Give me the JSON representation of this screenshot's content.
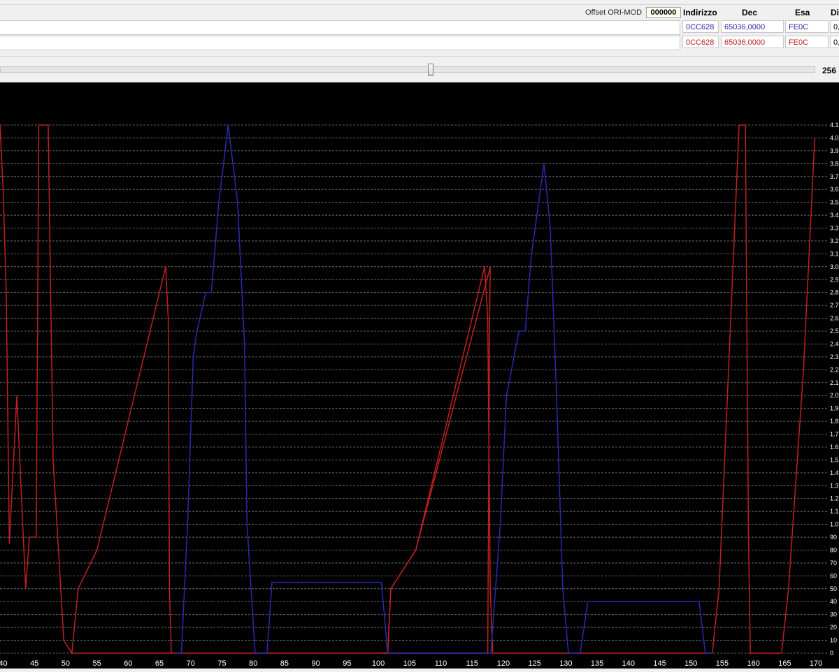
{
  "toolbar": {
    "offset_label": "Offset ORI-MOD",
    "offset_value": "000000",
    "col_address": "Indirizzo",
    "col_dec": "Dec",
    "col_hex": "Esa",
    "col_diff": "Di"
  },
  "rows": [
    {
      "address": "0CC628",
      "dec": "65036,0000",
      "hex": "FE0C",
      "diff": "0,",
      "color": "#2a2ab0"
    },
    {
      "address": "0CC628",
      "dec": "65036,0000",
      "hex": "FE0C",
      "diff": "0,",
      "color": "#c02020"
    }
  ],
  "slider": {
    "value": "256",
    "position": 0.528
  },
  "chart_data": {
    "type": "line",
    "xlim": [
      39.5,
      172
    ],
    "ylim": [
      0,
      4.1
    ],
    "x_ticks": [
      "40",
      "45",
      "50",
      "55",
      "60",
      "65",
      "70",
      "75",
      "80",
      "85",
      "90",
      "95",
      "100",
      "105",
      "110",
      "115",
      "120",
      "125",
      "130",
      "135",
      "140",
      "145",
      "150",
      "155",
      "160",
      "165",
      "170"
    ],
    "y_ticks": [
      "0",
      "10",
      "20",
      "30",
      "40",
      "50",
      "60",
      "70",
      "80",
      "90",
      "1.0",
      "1.1",
      "1.2",
      "1.3",
      "1.4",
      "1.5",
      "1.6",
      "1.7",
      "1.8",
      "1.9",
      "2.0",
      "2.1",
      "2.2",
      "2.3",
      "2.4",
      "2.5",
      "2.6",
      "2.7",
      "2.8",
      "2.9",
      "3.0",
      "3.1",
      "3.2",
      "3.3",
      "3.4",
      "3.5",
      "3.6",
      "3.7",
      "3.8",
      "3.9",
      "4.0",
      "4.1"
    ],
    "grid": true,
    "background": "#000000",
    "series": [
      {
        "color": "#c02020",
        "points": [
          [
            39.5,
            4.1
          ],
          [
            40.0,
            3.6
          ],
          [
            40.5,
            2.8
          ],
          [
            41.0,
            0.85
          ],
          [
            42.2,
            2.0
          ],
          [
            43.6,
            0.5
          ],
          [
            44.2,
            0.9
          ],
          [
            45.3,
            0.9
          ],
          [
            45.7,
            4.1
          ],
          [
            47.2,
            4.1
          ],
          [
            48.0,
            1.5
          ],
          [
            49.7,
            0.1
          ],
          [
            51.0,
            0.0
          ],
          [
            52.0,
            0.5
          ],
          [
            55.0,
            0.8
          ],
          [
            66.0,
            3.0
          ],
          [
            66.4,
            2.6
          ],
          [
            66.6,
            0.5
          ],
          [
            66.9,
            0.0
          ],
          [
            117.5,
            0.0
          ],
          [
            117.8,
            2.6
          ],
          [
            117.9,
            3.0
          ],
          [
            106.0,
            0.8
          ],
          [
            102.0,
            0.5
          ],
          [
            101.5,
            0.0
          ],
          [
            100.5,
            0.0
          ]
        ]
      },
      {
        "color": "#c02020",
        "points": [
          [
            51.0,
            0.0
          ],
          [
            66.9,
            0.0
          ]
        ]
      },
      {
        "color": "#c02020",
        "points": [
          [
            100.5,
            0.0
          ],
          [
            101.5,
            0.0
          ],
          [
            102.0,
            0.5
          ],
          [
            106.0,
            0.8
          ],
          [
            117.0,
            3.0
          ],
          [
            117.5,
            2.6
          ],
          [
            117.9,
            0.5
          ],
          [
            118.3,
            0.0
          ],
          [
            153.4,
            0.0
          ],
          [
            154.5,
            0.5
          ],
          [
            157.7,
            4.1
          ],
          [
            158.7,
            4.1
          ],
          [
            159.2,
            0.9
          ],
          [
            159.5,
            0.0
          ],
          [
            164.5,
            0.0
          ],
          [
            165.6,
            0.5
          ],
          [
            168.0,
            2.2
          ],
          [
            169.8,
            4.0
          ]
        ]
      },
      {
        "color": "#2a2ab0",
        "points": [
          [
            67.5,
            0.0
          ],
          [
            68.5,
            0.0
          ],
          [
            69.5,
            1.0
          ],
          [
            70.4,
            2.3
          ],
          [
            71.0,
            2.5
          ],
          [
            72.4,
            2.8
          ],
          [
            73.3,
            2.8
          ],
          [
            74.5,
            3.5
          ],
          [
            76.0,
            4.1
          ],
          [
            77.5,
            3.5
          ],
          [
            78.6,
            2.4
          ],
          [
            79.0,
            1.0
          ],
          [
            80.3,
            0.0
          ],
          [
            82.2,
            0.0
          ],
          [
            83.0,
            0.55
          ],
          [
            100.5,
            0.55
          ],
          [
            101.5,
            0.0
          ],
          [
            118.0,
            0.0
          ],
          [
            119.5,
            1.0
          ],
          [
            120.5,
            2.0
          ],
          [
            122.5,
            2.5
          ],
          [
            123.5,
            2.5
          ],
          [
            124.5,
            3.1
          ],
          [
            126.5,
            3.8
          ],
          [
            127.5,
            3.3
          ],
          [
            128.5,
            2.0
          ],
          [
            129.5,
            0.5
          ],
          [
            130.4,
            0.0
          ],
          [
            132.3,
            0.0
          ],
          [
            133.5,
            0.4
          ],
          [
            151.3,
            0.4
          ],
          [
            152.3,
            0.0
          ],
          [
            153.4,
            0.0
          ]
        ]
      }
    ]
  }
}
